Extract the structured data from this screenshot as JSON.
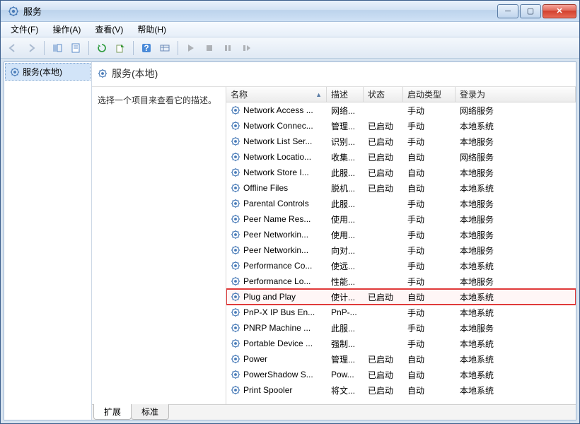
{
  "window": {
    "title": "服务"
  },
  "menu": {
    "file": "文件(F)",
    "action": "操作(A)",
    "view": "查看(V)",
    "help": "帮助(H)"
  },
  "tree": {
    "root": "服务(本地)"
  },
  "pane": {
    "title": "服务(本地)"
  },
  "desc": {
    "hint": "选择一个项目来查看它的描述。"
  },
  "columns": {
    "name": "名称",
    "desc": "描述",
    "status": "状态",
    "startup": "启动类型",
    "logon": "登录为"
  },
  "services": [
    {
      "name": "Network Access ...",
      "desc": "网络...",
      "status": "",
      "startup": "手动",
      "logon": "网络服务"
    },
    {
      "name": "Network Connec...",
      "desc": "管理...",
      "status": "已启动",
      "startup": "手动",
      "logon": "本地系统"
    },
    {
      "name": "Network List Ser...",
      "desc": "识别...",
      "status": "已启动",
      "startup": "手动",
      "logon": "本地服务"
    },
    {
      "name": "Network Locatio...",
      "desc": "收集...",
      "status": "已启动",
      "startup": "自动",
      "logon": "网络服务"
    },
    {
      "name": "Network Store I...",
      "desc": "此服...",
      "status": "已启动",
      "startup": "自动",
      "logon": "本地服务"
    },
    {
      "name": "Offline Files",
      "desc": "脱机...",
      "status": "已启动",
      "startup": "自动",
      "logon": "本地系统"
    },
    {
      "name": "Parental Controls",
      "desc": "此服...",
      "status": "",
      "startup": "手动",
      "logon": "本地服务"
    },
    {
      "name": "Peer Name Res...",
      "desc": "使用...",
      "status": "",
      "startup": "手动",
      "logon": "本地服务"
    },
    {
      "name": "Peer Networkin...",
      "desc": "使用...",
      "status": "",
      "startup": "手动",
      "logon": "本地服务"
    },
    {
      "name": "Peer Networkin...",
      "desc": "向对...",
      "status": "",
      "startup": "手动",
      "logon": "本地服务"
    },
    {
      "name": "Performance Co...",
      "desc": "使远...",
      "status": "",
      "startup": "手动",
      "logon": "本地系统"
    },
    {
      "name": "Performance Lo...",
      "desc": "性能...",
      "status": "",
      "startup": "手动",
      "logon": "本地服务"
    },
    {
      "name": "Plug and Play",
      "desc": "使计...",
      "status": "已启动",
      "startup": "自动",
      "logon": "本地系统",
      "highlight": true
    },
    {
      "name": "PnP-X IP Bus En...",
      "desc": "PnP-...",
      "status": "",
      "startup": "手动",
      "logon": "本地系统"
    },
    {
      "name": "PNRP Machine ...",
      "desc": "此服...",
      "status": "",
      "startup": "手动",
      "logon": "本地服务"
    },
    {
      "name": "Portable Device ...",
      "desc": "强制...",
      "status": "",
      "startup": "手动",
      "logon": "本地系统"
    },
    {
      "name": "Power",
      "desc": "管理...",
      "status": "已启动",
      "startup": "自动",
      "logon": "本地系统"
    },
    {
      "name": "PowerShadow S...",
      "desc": "Pow...",
      "status": "已启动",
      "startup": "自动",
      "logon": "本地系统"
    },
    {
      "name": "Print Spooler",
      "desc": "将文...",
      "status": "已启动",
      "startup": "自动",
      "logon": "本地系统"
    }
  ],
  "tabs": {
    "extended": "扩展",
    "standard": "标准"
  }
}
